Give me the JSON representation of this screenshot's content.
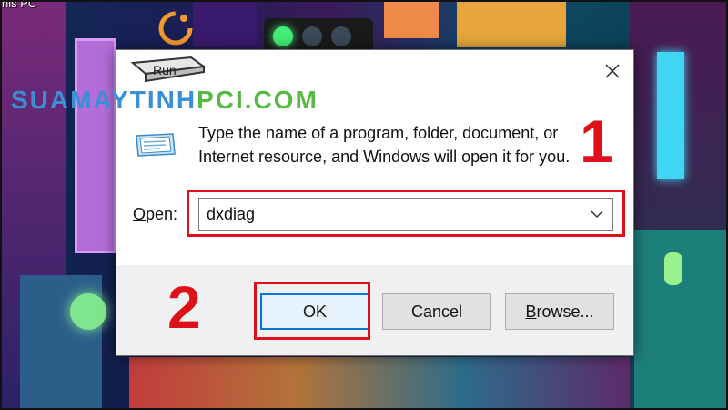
{
  "desktop": {
    "corner_label": "his PC",
    "watermark_part1": "SUAMAYTINH",
    "watermark_part2": "PCI.COM"
  },
  "dialog": {
    "title": "Run",
    "description": "Type the name of a program, folder, document, or Internet resource, and Windows will open it for you.",
    "open_label_accel": "O",
    "open_label_rest": "pen:",
    "open_value": "dxdiag",
    "buttons": {
      "ok": "OK",
      "cancel": "Cancel",
      "browse_accel": "B",
      "browse_rest": "rowse..."
    }
  },
  "annotations": {
    "step1": "1",
    "step2": "2",
    "color": "#e0101a"
  },
  "colors": {
    "focus_border": "#0078d7",
    "footer_bg": "#f0f0f0",
    "watermark_blue": "#3b8fd4",
    "watermark_green": "#58b947"
  }
}
